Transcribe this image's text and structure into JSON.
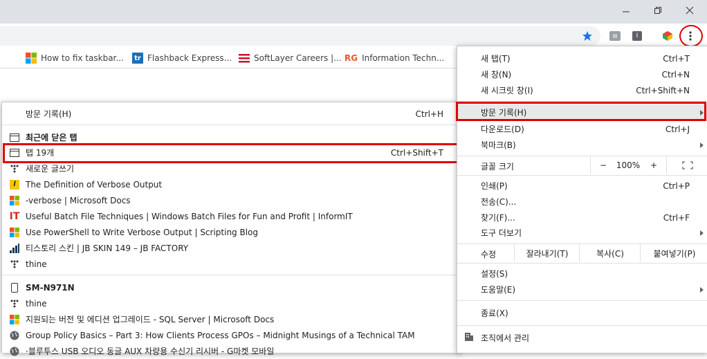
{
  "colors": {
    "accent_red": "#e00000",
    "star_blue": "#1a73e8"
  },
  "window": {
    "minimize_icon": "minimize-icon",
    "restore_icon": "restore-icon",
    "close_icon": "close-icon"
  },
  "bookmarks": [
    {
      "label": "How to fix taskbar...",
      "icon": "ms-logo"
    },
    {
      "label": "Flashback Express...",
      "icon": "tr-logo"
    },
    {
      "label": "SoftLayer Careers |...",
      "icon": "softlayer-logo"
    },
    {
      "label": "Information Techn...",
      "icon": "rg-logo",
      "icon_text": "RG"
    }
  ],
  "chrome_menu": {
    "new_tab": {
      "label": "새 탭(T)",
      "shortcut": "Ctrl+T"
    },
    "new_window": {
      "label": "새 창(N)",
      "shortcut": "Ctrl+N"
    },
    "incognito": {
      "label": "새 시크릿 창(I)",
      "shortcut": "Ctrl+Shift+N"
    },
    "history": {
      "label": "방문 기록(H)"
    },
    "downloads": {
      "label": "다운로드(D)",
      "shortcut": "Ctrl+J"
    },
    "bookmarks": {
      "label": "북마크(B)"
    },
    "zoom": {
      "label": "글꼴 크기",
      "minus": "−",
      "value": "100%",
      "plus": "+"
    },
    "print": {
      "label": "인쇄(P)",
      "shortcut": "Ctrl+P"
    },
    "cast": {
      "label": "전송(C)..."
    },
    "find": {
      "label": "찾기(F)...",
      "shortcut": "Ctrl+F"
    },
    "more_tools": {
      "label": "도구 더보기"
    },
    "edit": {
      "label": "수정",
      "cut": "잘라내기(T)",
      "copy": "복사(C)",
      "paste": "붙여넣기(P)"
    },
    "settings": {
      "label": "설정(S)"
    },
    "help": {
      "label": "도움말(E)"
    },
    "exit": {
      "label": "종료(X)"
    },
    "managed": {
      "label": "조직에서 관리"
    }
  },
  "history_menu": {
    "history": {
      "label": "방문 기록(H)",
      "shortcut": "Ctrl+H"
    },
    "recently_closed": {
      "label": "최근에 닫은 탭"
    },
    "tabs": {
      "label": "탭 19개",
      "shortcut": "Ctrl+Shift+T"
    },
    "items1": [
      {
        "label": "새로운 글쓰기",
        "icon": "dots-icon"
      },
      {
        "label": "The Definition of Verbose Output",
        "icon": "l-logo-icon"
      },
      {
        "label": "-verbose | Microsoft Docs",
        "icon": "ms-logo-icon"
      },
      {
        "label": "Useful Batch File Techniques | Windows Batch Files for Fun and Profit | InformIT",
        "icon": "it-logo-icon"
      },
      {
        "label": "Use PowerShell to Write Verbose Output | Scripting Blog",
        "icon": "ms-logo-icon"
      },
      {
        "label": "티스토리 스킨 | JB SKIN 149 – JB FACTORY",
        "icon": "bars-icon"
      },
      {
        "label": "thine",
        "icon": "dots-icon"
      }
    ],
    "device": {
      "label": "SM-N971N"
    },
    "items2": [
      {
        "label": "thine",
        "icon": "dots-icon"
      },
      {
        "label": "지원되는 버전 및 에디션 업그레이드 - SQL Server | Microsoft Docs",
        "icon": "ms-logo-icon"
      },
      {
        "label": "Group Policy Basics – Part 3: How Clients Process GPOs – Midnight Musings of a Technical TAM",
        "icon": "globe-icon"
      },
      {
        "label": "·블루투스 USB 오디오 동글 AUX 차량용 수신기 리시버 - G마켓 모바일",
        "icon": "globe-icon"
      }
    ]
  }
}
